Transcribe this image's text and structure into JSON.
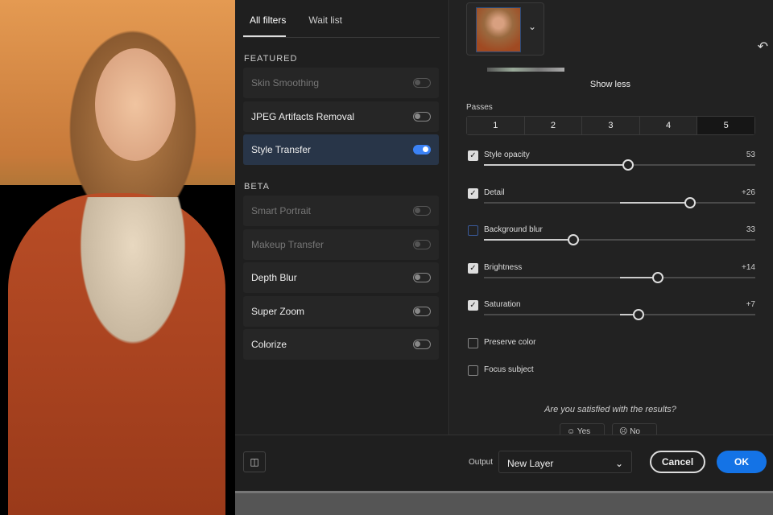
{
  "tabs": [
    "All filters",
    "Wait list"
  ],
  "featured_label": "FEATURED",
  "beta_label": "BETA",
  "featured": [
    {
      "label": "Skin Smoothing",
      "on": false,
      "dim": true
    },
    {
      "label": "JPEG Artifacts Removal",
      "on": false,
      "dim": false
    },
    {
      "label": "Style Transfer",
      "on": true,
      "dim": false
    }
  ],
  "beta": [
    {
      "label": "Smart Portrait",
      "on": false,
      "dim": true
    },
    {
      "label": "Makeup Transfer",
      "on": false,
      "dim": true
    },
    {
      "label": "Depth Blur",
      "on": false,
      "dim": false
    },
    {
      "label": "Super Zoom",
      "on": false,
      "dim": false
    },
    {
      "label": "Colorize",
      "on": false,
      "dim": false
    }
  ],
  "show_less": "Show less",
  "passes_label": "Passes",
  "passes": [
    "1",
    "2",
    "3",
    "4",
    "5"
  ],
  "active_pass": "5",
  "sliders": [
    {
      "label": "Style opacity",
      "value": "53",
      "num": 53,
      "checked": true,
      "bipolar": false
    },
    {
      "label": "Detail",
      "value": "+26",
      "num": 26,
      "checked": true,
      "bipolar": true
    },
    {
      "label": "Background blur",
      "value": "33",
      "num": 33,
      "checked": false,
      "bipolar": false
    },
    {
      "label": "Brightness",
      "value": "+14",
      "num": 14,
      "checked": true,
      "bipolar": true
    },
    {
      "label": "Saturation",
      "value": "+7",
      "num": 7,
      "checked": true,
      "bipolar": true
    }
  ],
  "preserve_color": "Preserve color",
  "focus_subject": "Focus subject",
  "question": "Are you satisfied with the results?",
  "yes": "Yes",
  "no": "No",
  "output_label": "Output",
  "output_value": "New Layer",
  "cancel": "Cancel",
  "ok": "OK",
  "accent": "#1473e6"
}
